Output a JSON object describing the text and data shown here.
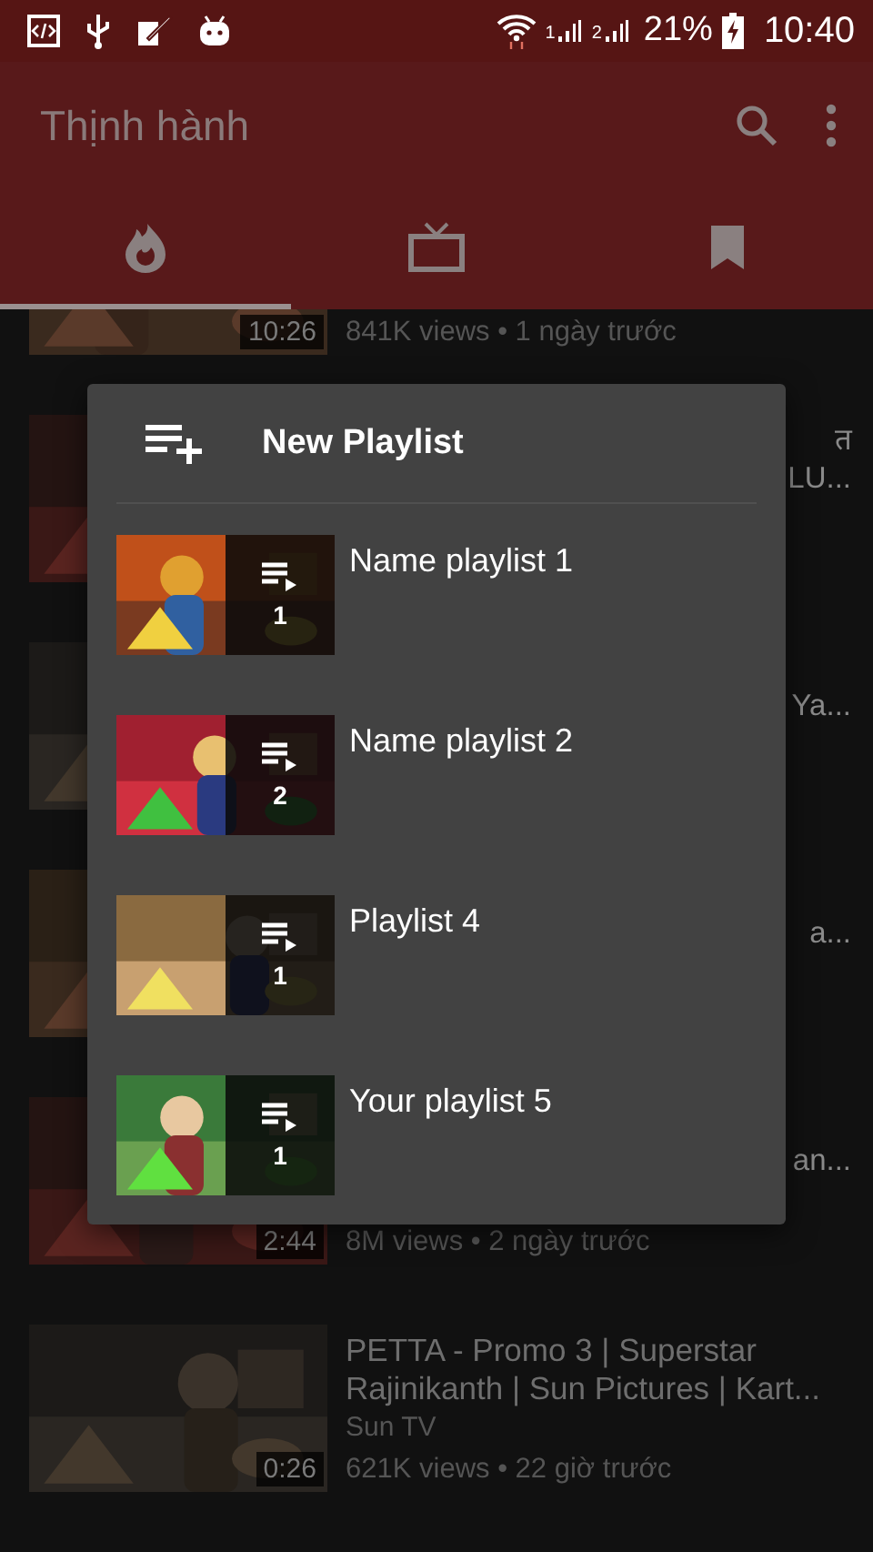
{
  "status_bar": {
    "sim_1": "1",
    "sim_2": "2",
    "battery": "21%",
    "time": "10:40"
  },
  "app_bar": {
    "title": "Thịnh hành"
  },
  "tabs": [
    {
      "kind": "trending",
      "selected": true
    },
    {
      "kind": "subscriptions",
      "selected": false
    },
    {
      "kind": "saved",
      "selected": false
    }
  ],
  "videos": [
    {
      "duration": "10:26",
      "meta": "841K views • 1 ngày trước"
    },
    {
      "title_line_1_end": "त",
      "title_line_2_end": "LU..."
    },
    {
      "title_line_2_end": "Ya..."
    },
    {
      "title_line_2_end": "a..."
    },
    {
      "title_line_2_end": "an...",
      "duration": "2:44",
      "meta": "8M views • 2 ngày trước"
    },
    {
      "title_lines": [
        "PETTA - Promo 3 | Superstar",
        "Rajinikanth | Sun Pictures | Kart..."
      ],
      "channel": "Sun TV",
      "duration": "0:26",
      "meta": "621K views • 22 giờ trước"
    }
  ],
  "dialog": {
    "title": "New Playlist",
    "playlists": [
      {
        "name": "Name playlist 1",
        "count": "1"
      },
      {
        "name": "Name playlist 2",
        "count": "2"
      },
      {
        "name": "Playlist 4",
        "count": "1"
      },
      {
        "name": "Your playlist 5",
        "count": "1"
      }
    ]
  }
}
